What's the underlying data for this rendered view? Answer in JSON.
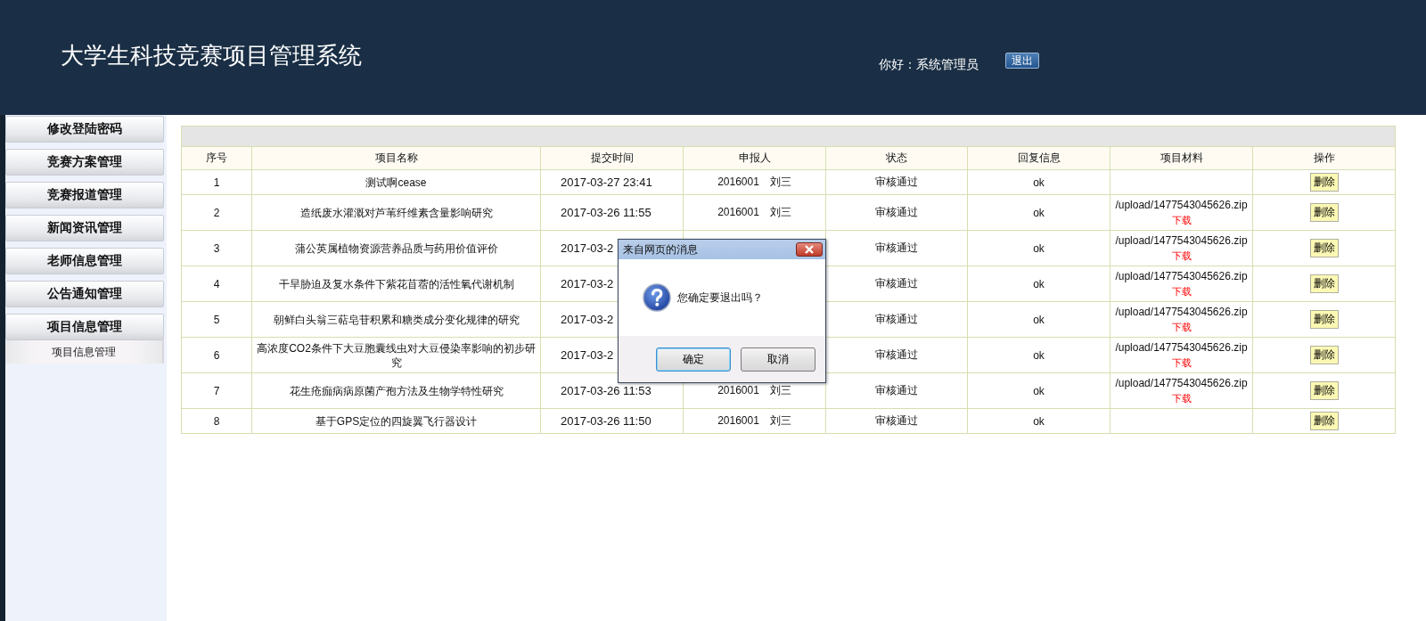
{
  "header": {
    "title": "大学生科技竞赛项目管理系统",
    "greeting": "你好：系统管理员",
    "logout_button": "退出"
  },
  "sidebar": {
    "items": [
      {
        "label": "修改登陆密码"
      },
      {
        "label": "竞赛方案管理"
      },
      {
        "label": "竞赛报道管理"
      },
      {
        "label": "新闻资讯管理"
      },
      {
        "label": "老师信息管理"
      },
      {
        "label": "公告通知管理"
      },
      {
        "label": "项目信息管理",
        "children": [
          {
            "label": "项目信息管理"
          }
        ]
      }
    ]
  },
  "table": {
    "columns": [
      "序号",
      "项目名称",
      "提交时间",
      "申报人",
      "状态",
      "回复信息",
      "项目材料",
      "操作"
    ],
    "rows": [
      {
        "no": "1",
        "name": "测试啊cease",
        "time": "2017-03-27 23:41",
        "applicant": "2016001　刘三",
        "status": "审核通过",
        "reply": "ok",
        "action": "删除"
      },
      {
        "no": "2",
        "name": "造纸废水灌溉对芦苇纤维素含量影响研究",
        "time": "2017-03-26 11:55",
        "applicant": "2016001　刘三",
        "status": "审核通过",
        "reply": "ok",
        "material": {
          "path": "/upload/1477543045626.zip",
          "link": "下载"
        },
        "action": "删除"
      },
      {
        "no": "3",
        "name": "蒲公英属植物资源营养品质与药用价值评价",
        "time": "2017-03-2",
        "status": "审核通过",
        "reply": "ok",
        "material": {
          "path": "/upload/1477543045626.zip",
          "link": "下载"
        },
        "action": "删除"
      },
      {
        "no": "4",
        "name": "干旱胁迫及复水条件下紫花苜蓿的活性氧代谢机制",
        "time": "2017-03-2",
        "status": "审核通过",
        "reply": "ok",
        "material": {
          "path": "/upload/1477543045626.zip",
          "link": "下载"
        },
        "action": "删除"
      },
      {
        "no": "5",
        "name": "朝鲜白头翁三萜皂苷积累和糖类成分变化规律的研究",
        "time": "2017-03-2",
        "status": "审核通过",
        "reply": "ok",
        "material": {
          "path": "/upload/1477543045626.zip",
          "link": "下载"
        },
        "action": "删除"
      },
      {
        "no": "6",
        "name": "高浓度CO2条件下大豆胞囊线虫对大豆侵染率影响的初步研究",
        "time": "2017-03-2",
        "status": "审核通过",
        "reply": "ok",
        "material": {
          "path": "/upload/1477543045626.zip",
          "link": "下载"
        },
        "action": "删除"
      },
      {
        "no": "7",
        "name": "花生疮痂病病原菌产孢方法及生物学特性研究",
        "time": "2017-03-26 11:53",
        "applicant": "2016001　刘三",
        "status": "审核通过",
        "reply": "ok",
        "material": {
          "path": "/upload/1477543045626.zip",
          "link": "下载"
        },
        "action": "删除"
      },
      {
        "no": "8",
        "name": "基于GPS定位的四旋翼飞行器设计",
        "time": "2017-03-26 11:50",
        "applicant": "2016001　刘三",
        "status": "审核通过",
        "reply": "ok",
        "action": "删除"
      }
    ]
  },
  "dialog": {
    "title": "来自网页的消息",
    "message": "您确定要退出吗？",
    "buttons": [
      {
        "label": "确定",
        "default": true
      },
      {
        "label": "取消",
        "default": false
      }
    ]
  }
}
